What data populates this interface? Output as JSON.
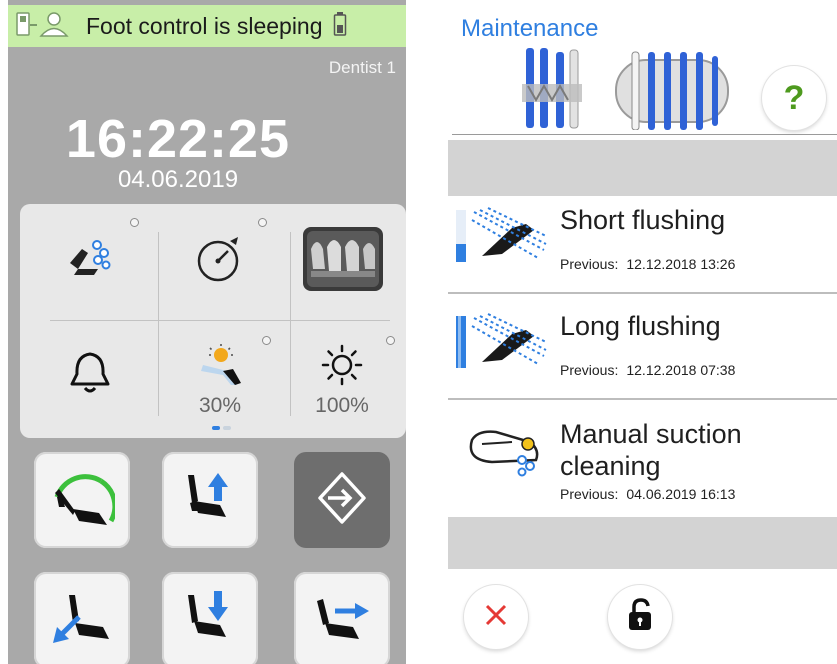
{
  "status_bar": {
    "text": "Foot control is sleeping",
    "icons": [
      "foot-control-icon",
      "user-icon",
      "battery-icon"
    ],
    "background": "#c8eea8"
  },
  "user": {
    "name": "Dentist 1"
  },
  "clock": {
    "time": "16:22:25",
    "date": "04.06.2019"
  },
  "quick_panel": {
    "items": [
      {
        "icon": "instrument-spray-icon"
      },
      {
        "icon": "timer-icon"
      },
      {
        "icon": "xray-image-icon"
      },
      {
        "icon": "bell-icon"
      },
      {
        "icon": "dental-light-dim-icon",
        "label": "30%"
      },
      {
        "icon": "brightness-icon",
        "label": "100%"
      }
    ],
    "page_count": 2,
    "current_page": 1
  },
  "chair_controls": [
    {
      "icon": "chair-program-icon"
    },
    {
      "icon": "chair-up-icon"
    },
    {
      "icon": "login-icon"
    },
    {
      "icon": "chair-back-down-icon"
    },
    {
      "icon": "chair-down-icon"
    },
    {
      "icon": "chair-back-up-icon"
    }
  ],
  "maintenance": {
    "title": "Maintenance",
    "items": [
      {
        "title": "Short flushing",
        "previous_label": "Previous:",
        "previous_value": "12.12.2018 13:26",
        "icon": "short-flushing-icon"
      },
      {
        "title": "Long flushing",
        "previous_label": "Previous:",
        "previous_value": "12.12.2018 07:38",
        "icon": "long-flushing-icon"
      },
      {
        "title_line1": "Manual suction",
        "title_line2": "cleaning",
        "previous_label": "Previous:",
        "previous_value": "04.06.2019 16:13",
        "icon": "suction-cleaning-icon"
      }
    ],
    "help_label": "?",
    "buttons": {
      "close": "close-icon",
      "unlock": "unlock-icon"
    }
  },
  "colors": {
    "accent": "#2f7fe0",
    "status_green": "#c8eea8",
    "panel_gray": "#a9a9a9",
    "help_green": "#4e9a1e",
    "close_red": "#e53935"
  }
}
